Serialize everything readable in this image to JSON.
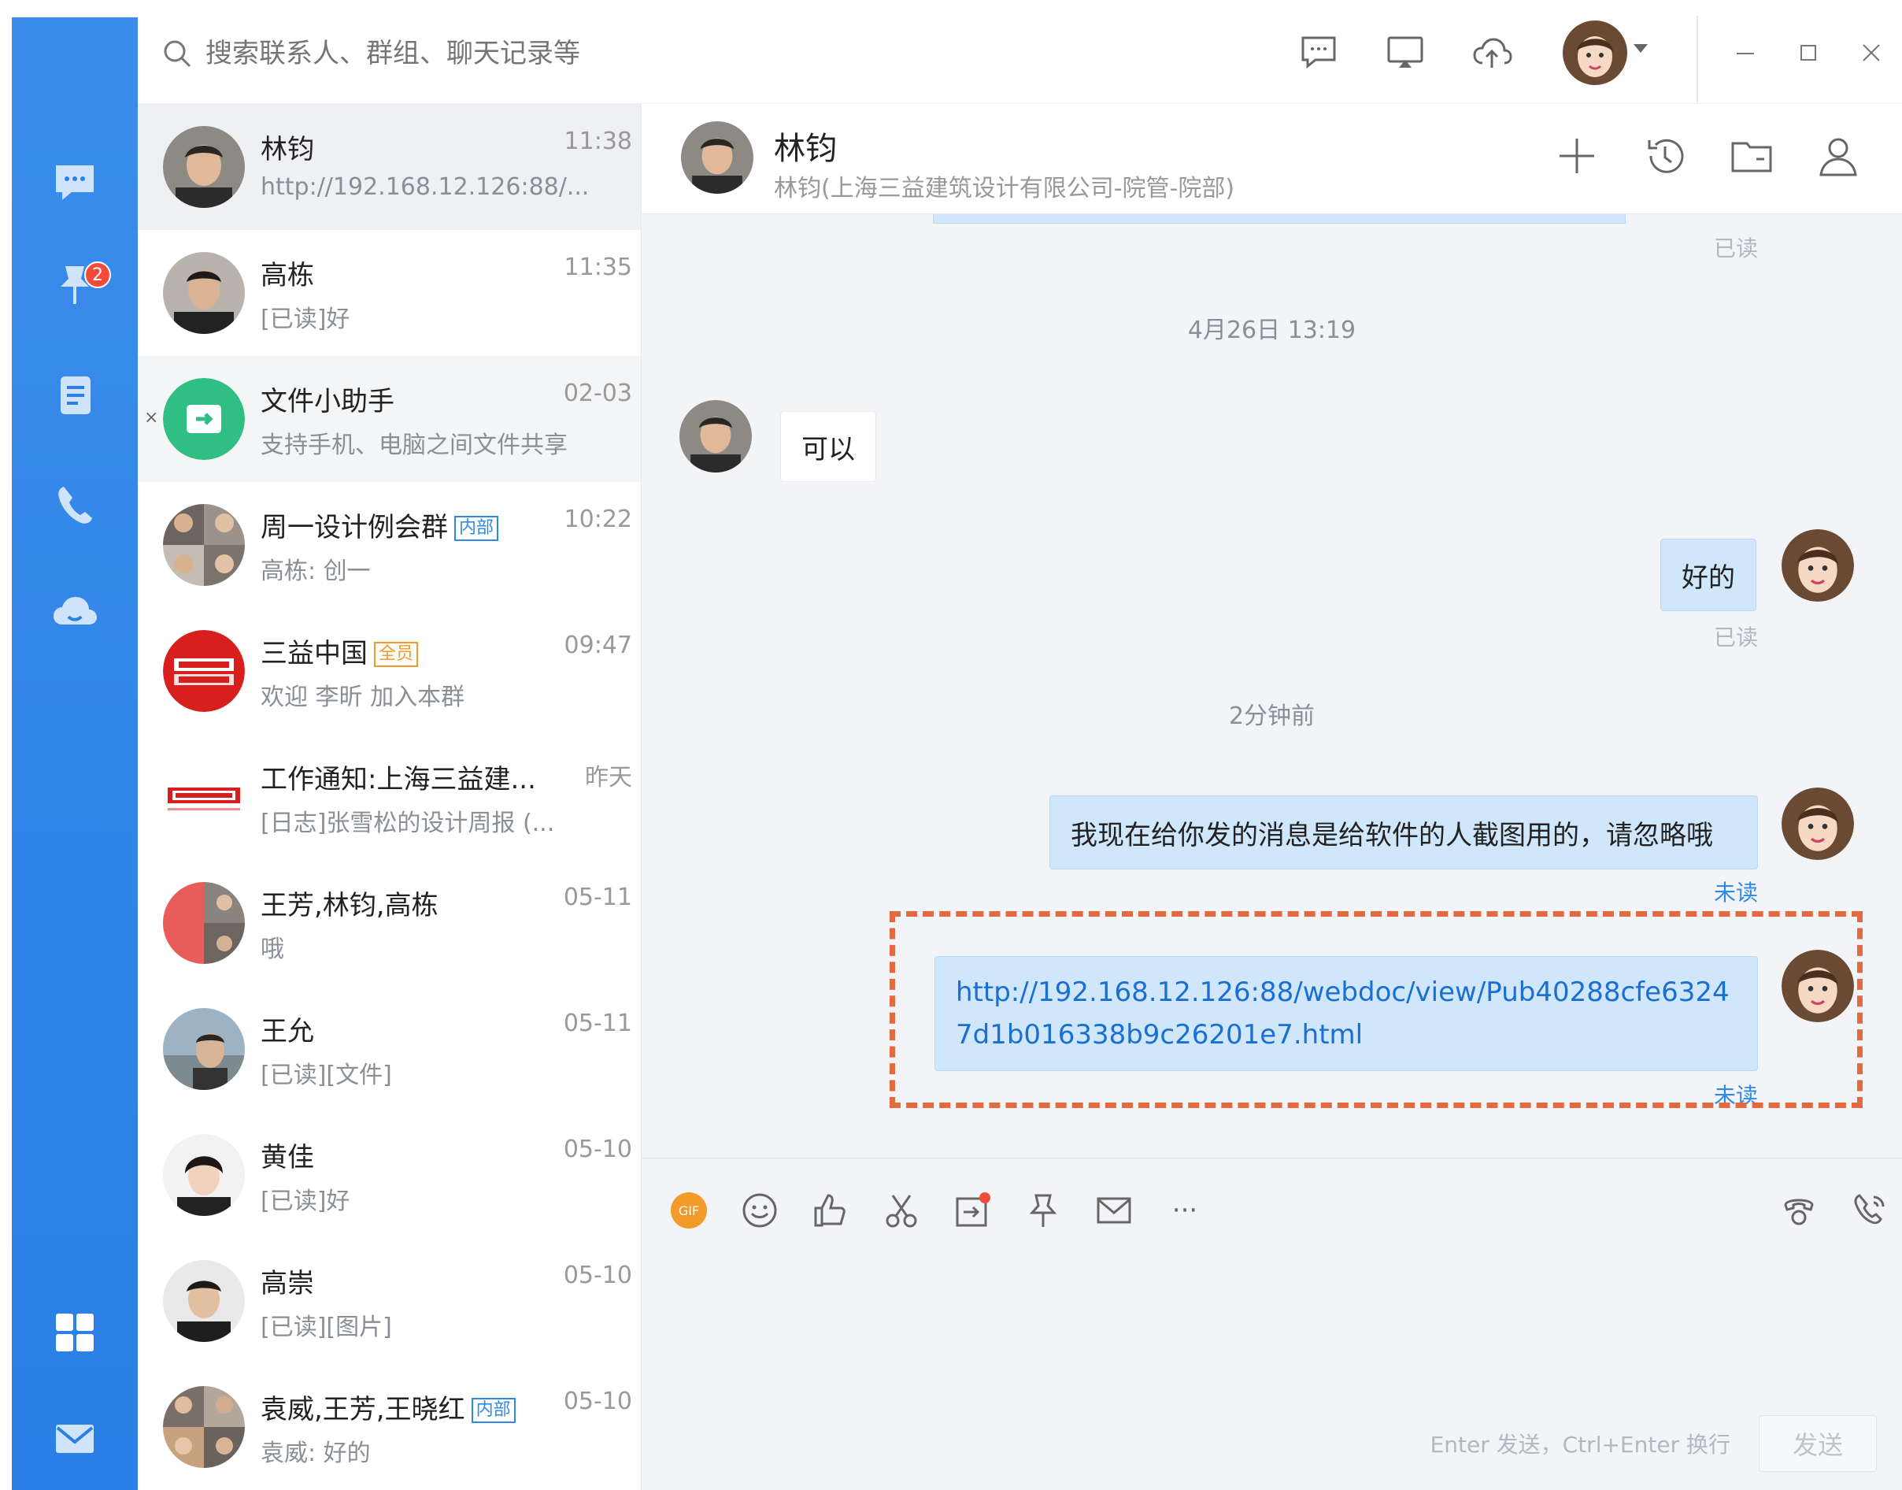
{
  "search": {
    "placeholder": "搜索联系人、群组、聊天记录等"
  },
  "rail": {
    "tasks_badge": "2"
  },
  "conversations": [
    {
      "name": "林钧",
      "time": "11:38",
      "preview": "http://192.168.12.126:88/...",
      "tag": ""
    },
    {
      "name": "高栋",
      "time": "11:35",
      "preview": "[已读]好",
      "tag": ""
    },
    {
      "name": "文件小助手",
      "time": "02-03",
      "preview": "支持手机、电脑之间文件共享",
      "tag": "",
      "close": "×"
    },
    {
      "name": "周一设计例会群",
      "time": "10:22",
      "preview": "高栋: 创一",
      "tag": "内部"
    },
    {
      "name": "三益中国",
      "time": "09:47",
      "preview": "欢迎 李昕 加入本群",
      "tag": "全员"
    },
    {
      "name": "工作通知:上海三益建...",
      "time": "昨天",
      "preview": "[日志]张雪松的设计周报 (...",
      "tag": ""
    },
    {
      "name": "王芳,林钧,高栋",
      "time": "05-11",
      "preview": "哦",
      "tag": ""
    },
    {
      "name": "王允",
      "time": "05-11",
      "preview": "[已读][文件]",
      "tag": ""
    },
    {
      "name": "黄佳",
      "time": "05-10",
      "preview": "[已读]好",
      "tag": ""
    },
    {
      "name": "高崇",
      "time": "05-10",
      "preview": "[已读][图片]",
      "tag": ""
    },
    {
      "name": "袁威,王芳,王晓红",
      "time": "05-10",
      "preview": "袁威: 好的",
      "tag": "内部"
    }
  ],
  "chat": {
    "title": "林钧",
    "subtitle": "林钧(上海三益建筑设计有限公司-院管-院部)",
    "read_label": "已读",
    "unread_label": "未读",
    "timestamps": [
      "4月26日 13:19",
      "2分钟前"
    ],
    "messages": [
      {
        "dir": "in",
        "text": "可以"
      },
      {
        "dir": "out",
        "text": "好的"
      },
      {
        "dir": "out",
        "text": "我现在给你发的消息是给软件的人截图用的，请忽略哦"
      },
      {
        "dir": "out",
        "text": "http://192.168.12.126:88/webdoc/view/Pub40288cfe63247d1b016338b9c26201e7.html"
      }
    ]
  },
  "composer": {
    "gif_label": "GIF",
    "more_label": "···",
    "hint": "Enter 发送，Ctrl+Enter 换行",
    "send_label": "发送"
  },
  "colors": {
    "rail": "#2a7fe6",
    "accent": "#2f8ae6",
    "bubble_out": "#cfe6fb",
    "highlight": "#e36a3e"
  }
}
